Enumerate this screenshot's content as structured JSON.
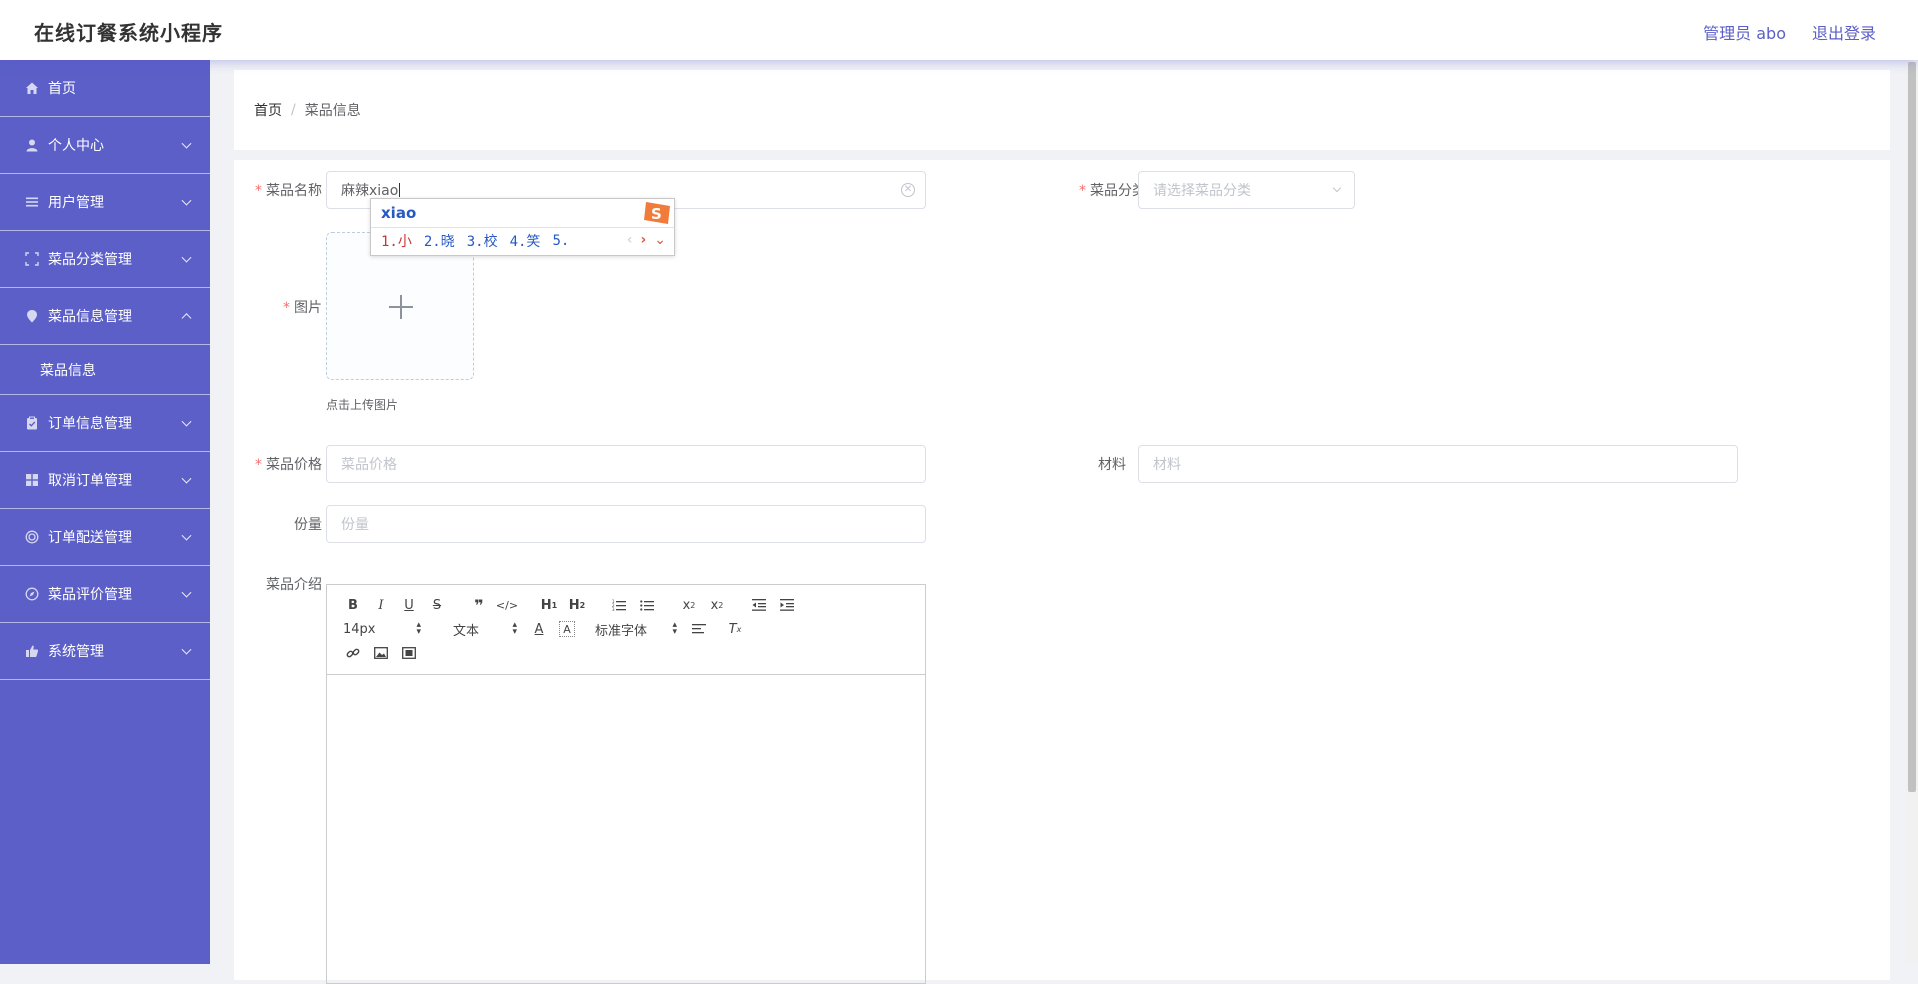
{
  "header": {
    "app_title": "在线订餐系统小程序",
    "user_label": "管理员 abo",
    "logout_label": "退出登录"
  },
  "sidebar": {
    "items": [
      {
        "label": "首页",
        "icon": "home-icon"
      },
      {
        "label": "个人中心",
        "icon": "user-icon"
      },
      {
        "label": "用户管理",
        "icon": "list-icon"
      },
      {
        "label": "菜品分类管理",
        "icon": "crop-icon"
      },
      {
        "label": "菜品信息管理",
        "icon": "location-icon",
        "expanded": true
      },
      {
        "label": "订单信息管理",
        "icon": "clipboard-icon"
      },
      {
        "label": "取消订单管理",
        "icon": "grid-icon"
      },
      {
        "label": "订单配送管理",
        "icon": "circle-icon"
      },
      {
        "label": "菜品评价管理",
        "icon": "compass-icon"
      },
      {
        "label": "系统管理",
        "icon": "thumb-icon"
      }
    ],
    "sub_item": "菜品信息"
  },
  "breadcrumb": {
    "home": "首页",
    "separator": "/",
    "current": "菜品信息"
  },
  "form": {
    "name_label": "菜品名称",
    "name_value": "麻辣xiao",
    "category_label": "菜品分类",
    "category_placeholder": "请选择菜品分类",
    "image_label": "图片",
    "upload_tip": "点击上传图片",
    "price_label": "菜品价格",
    "price_placeholder": "菜品价格",
    "material_label": "材料",
    "material_placeholder": "材料",
    "portion_label": "份量",
    "portion_placeholder": "份量",
    "intro_label": "菜品介绍"
  },
  "editor": {
    "font_size": "14px",
    "paragraph": "文本",
    "font_family": "标准字体"
  },
  "ime": {
    "pinyin": "xiao",
    "candidates": [
      "1.小",
      "2.晓",
      "3.校",
      "4.笑",
      "5."
    ]
  },
  "colors": {
    "sidebar": "#5b5fc7",
    "accent": "#5b5fc7",
    "required": "#f56c6c"
  }
}
